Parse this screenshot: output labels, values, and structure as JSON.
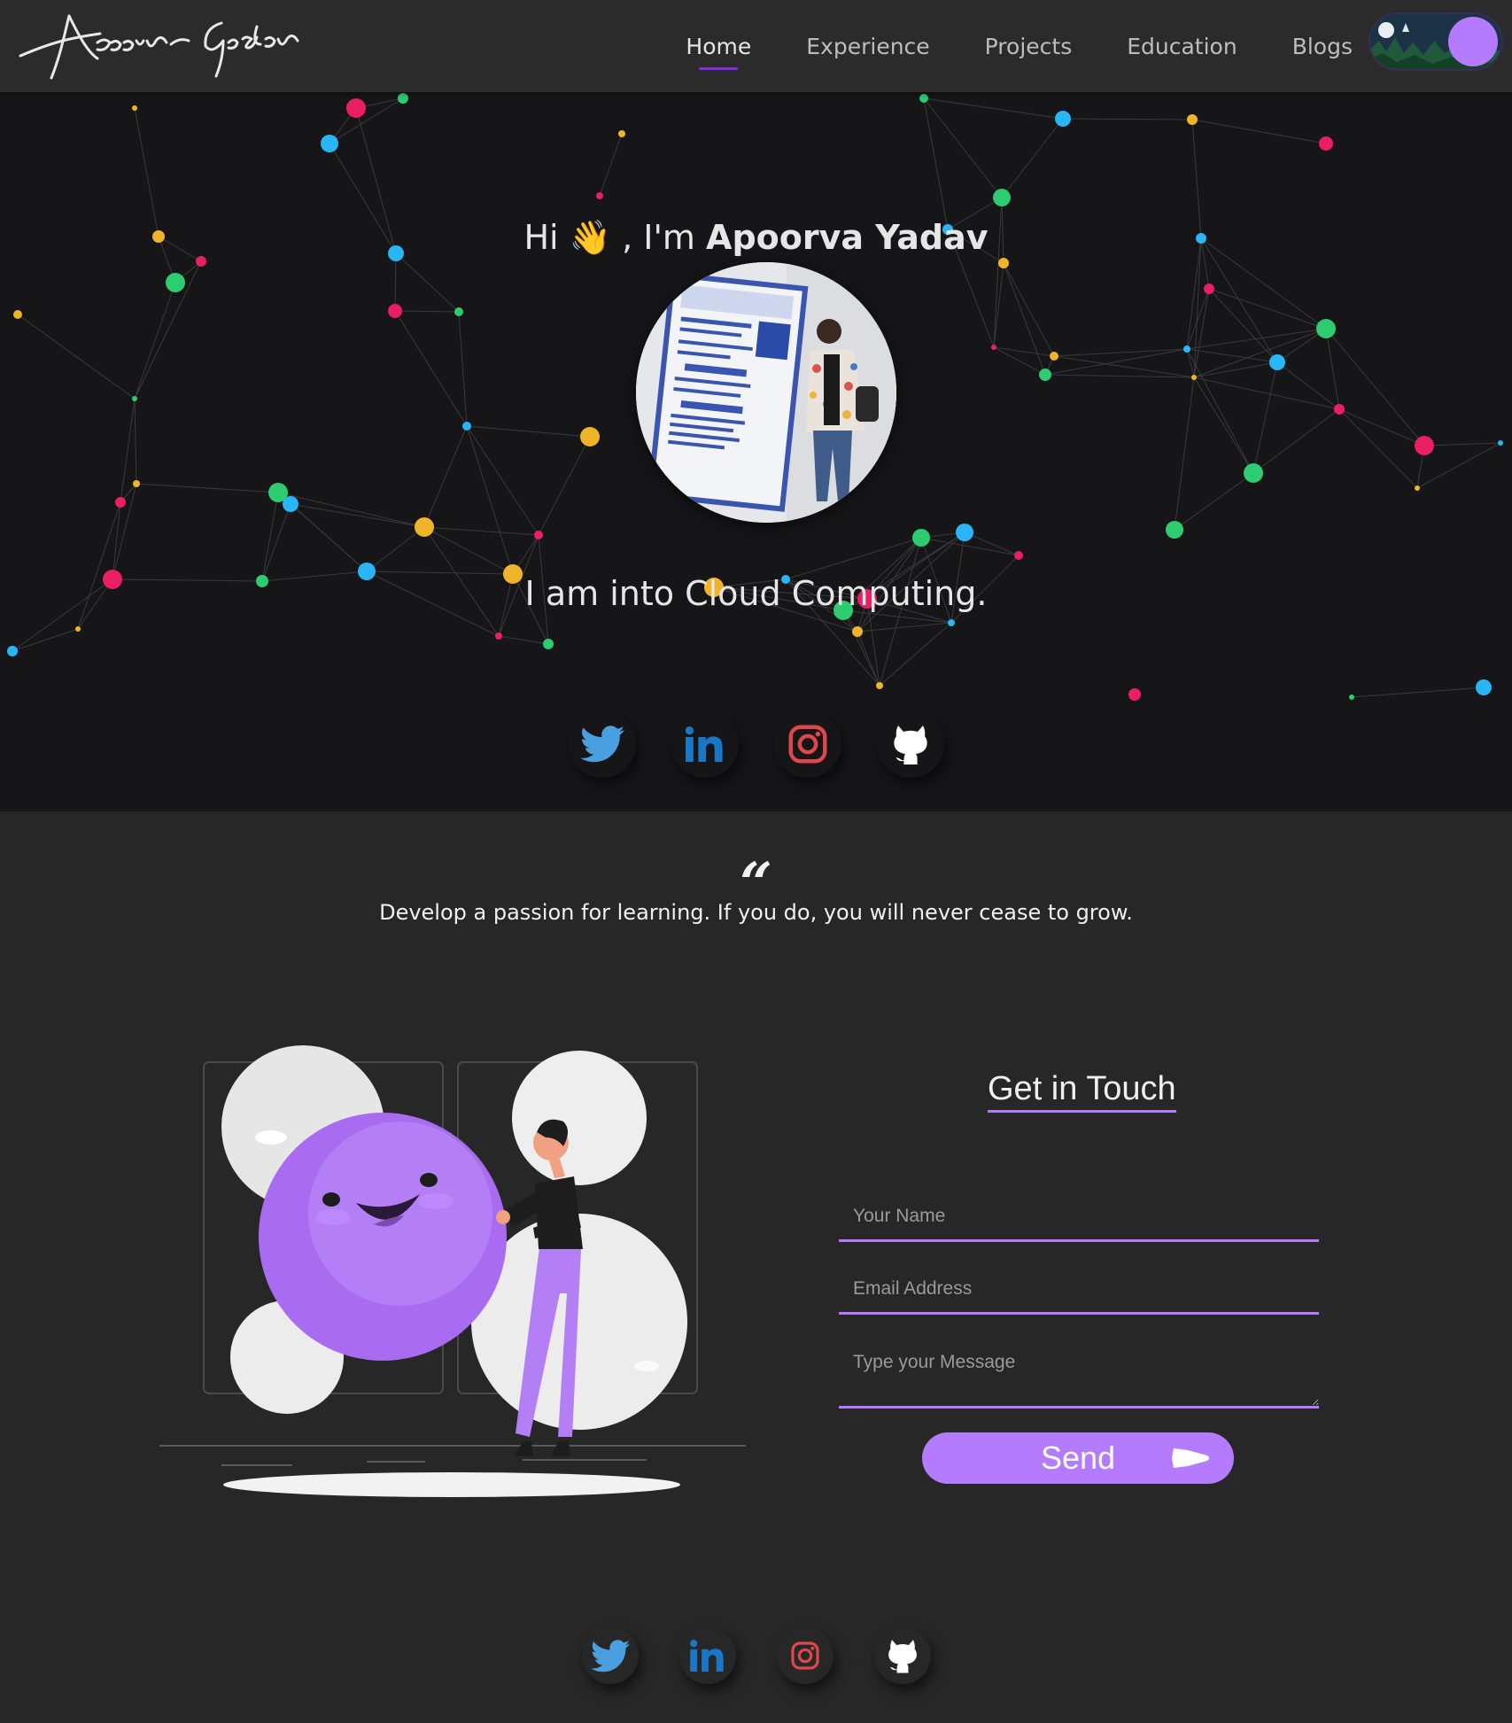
{
  "nav": {
    "logo_text": "Apoorva Yadav",
    "links": [
      {
        "label": "Home",
        "active": true
      },
      {
        "label": "Experience",
        "active": false
      },
      {
        "label": "Projects",
        "active": false
      },
      {
        "label": "Education",
        "active": false
      },
      {
        "label": "Blogs",
        "active": false
      }
    ],
    "theme_toggle": "dark"
  },
  "hero": {
    "greeting_prefix": "Hi",
    "greeting_emoji": "👋",
    "greeting_middle": ", I'm",
    "name": "Apoorva Yadav",
    "tagline": "I am into Cloud Computing.",
    "avatar_alt": "profile-photo",
    "socials": [
      {
        "name": "twitter-icon",
        "color": "#4a9fe0"
      },
      {
        "name": "linkedin-icon",
        "color": "#1a76c7"
      },
      {
        "name": "instagram-icon",
        "color": "#e0474c"
      },
      {
        "name": "github-icon",
        "color": "#ffffff"
      }
    ]
  },
  "quote": {
    "mark": "“",
    "text": "Develop a passion for learning. If you do, you will never cease to grow."
  },
  "contact": {
    "title": "Get in Touch",
    "name_placeholder": "Your Name",
    "email_placeholder": "Email Address",
    "message_placeholder": "Type your Message",
    "send_label": "Send"
  },
  "colors": {
    "accent": "#b57bff",
    "nav_bg": "#2b2b2b",
    "hero_bg": "#161618",
    "page_bg": "#272727"
  }
}
